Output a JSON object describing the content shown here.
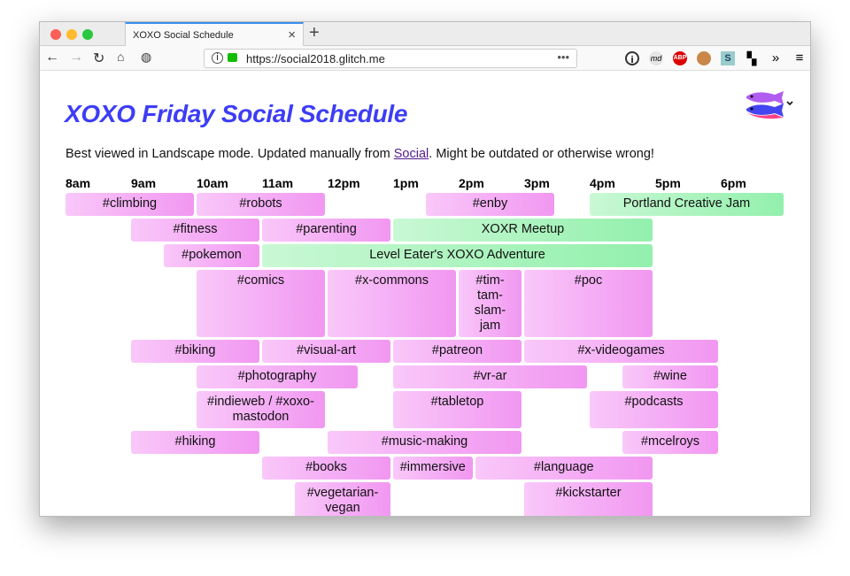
{
  "browser": {
    "tab_title": "XOXO Social Schedule",
    "url": "https://social2018.glitch.me",
    "colors": {
      "close": "#fc5f57",
      "min": "#fdbc2e",
      "max": "#29c840"
    },
    "toolbar_icons": [
      "info-icon",
      "markdown-icon",
      "adblock-plus-icon",
      "tampermonkey-icon",
      "stylus-icon",
      "add-extension-icon",
      "overflow-chevron-icon",
      "menu-icon"
    ],
    "extension_labels": {
      "md": "md",
      "abp": "ABP",
      "s": "S"
    }
  },
  "page": {
    "title": "XOXO Friday Social Schedule",
    "note_before": "Best viewed in Landscape mode. Updated manually from ",
    "note_link": "Social",
    "note_after": ". Might be outdated or otherwise wrong!",
    "hours": [
      "8am",
      "9am",
      "10am",
      "11am",
      "12pm",
      "1pm",
      "2pm",
      "3pm",
      "4pm",
      "5pm",
      "6pm"
    ],
    "colors": {
      "title": "#3d3df5",
      "channel": "#f197f1",
      "event": "#93f0ad"
    },
    "events": [
      {
        "name": "#climbing",
        "start": 8,
        "end": 10,
        "row": 1,
        "kind": "channel"
      },
      {
        "name": "#robots",
        "start": 10,
        "end": 12,
        "row": 1,
        "kind": "channel"
      },
      {
        "name": "#enby",
        "start": 13.5,
        "end": 15.5,
        "row": 1,
        "kind": "channel"
      },
      {
        "name": "Portland Creative Jam",
        "start": 16,
        "end": 19,
        "row": 1,
        "kind": "event"
      },
      {
        "name": "#fitness",
        "start": 9,
        "end": 11,
        "row": 2,
        "kind": "channel"
      },
      {
        "name": "#parenting",
        "start": 11,
        "end": 13,
        "row": 2,
        "kind": "channel"
      },
      {
        "name": "XOXR Meetup",
        "start": 13,
        "end": 17,
        "row": 2,
        "kind": "event"
      },
      {
        "name": "#pokemon",
        "start": 9.5,
        "end": 11,
        "row": 3,
        "kind": "channel"
      },
      {
        "name": "Level Eater's XOXO Adventure",
        "start": 11,
        "end": 17,
        "row": 3,
        "kind": "event"
      },
      {
        "name": "#comics",
        "start": 10,
        "end": 12,
        "row": 4,
        "kind": "channel"
      },
      {
        "name": "#x-commons",
        "start": 12,
        "end": 14,
        "row": 4,
        "kind": "channel"
      },
      {
        "name": "#tim-tam-slam-jam",
        "start": 14,
        "end": 15,
        "row": 4,
        "kind": "channel"
      },
      {
        "name": "#poc",
        "start": 15,
        "end": 17,
        "row": 4,
        "kind": "channel"
      },
      {
        "name": "#biking",
        "start": 9,
        "end": 11,
        "row": 5,
        "kind": "channel"
      },
      {
        "name": "#visual-art",
        "start": 11,
        "end": 13,
        "row": 5,
        "kind": "channel"
      },
      {
        "name": "#patreon",
        "start": 13,
        "end": 15,
        "row": 5,
        "kind": "channel"
      },
      {
        "name": "#x-videogames",
        "start": 15,
        "end": 18,
        "row": 5,
        "kind": "channel"
      },
      {
        "name": "#photography",
        "start": 10,
        "end": 12.5,
        "row": 6,
        "kind": "channel"
      },
      {
        "name": "#vr-ar",
        "start": 13,
        "end": 16,
        "row": 6,
        "kind": "channel"
      },
      {
        "name": "#wine",
        "start": 16.5,
        "end": 18,
        "row": 6,
        "kind": "channel"
      },
      {
        "name": "#indieweb / #xoxo-mastodon",
        "start": 10,
        "end": 12,
        "row": 7,
        "kind": "channel"
      },
      {
        "name": "#tabletop",
        "start": 13,
        "end": 15,
        "row": 7,
        "kind": "channel"
      },
      {
        "name": "#podcasts",
        "start": 16,
        "end": 18,
        "row": 7,
        "kind": "channel"
      },
      {
        "name": "#hiking",
        "start": 9,
        "end": 11,
        "row": 8,
        "kind": "channel"
      },
      {
        "name": "#music-making",
        "start": 12,
        "end": 15,
        "row": 8,
        "kind": "channel"
      },
      {
        "name": "#mcelroys",
        "start": 16.5,
        "end": 18,
        "row": 8,
        "kind": "channel"
      },
      {
        "name": "#books",
        "start": 11,
        "end": 13,
        "row": 9,
        "kind": "channel"
      },
      {
        "name": "#immersive",
        "start": 13,
        "end": 14.25,
        "row": 9,
        "kind": "channel"
      },
      {
        "name": "#language",
        "start": 14.25,
        "end": 17,
        "row": 9,
        "kind": "channel"
      },
      {
        "name": "#vegetarian-vegan",
        "start": 11.5,
        "end": 13,
        "row": 10,
        "kind": "channel"
      },
      {
        "name": "#kickstarter",
        "start": 15,
        "end": 17,
        "row": 10,
        "kind": "channel"
      }
    ]
  }
}
